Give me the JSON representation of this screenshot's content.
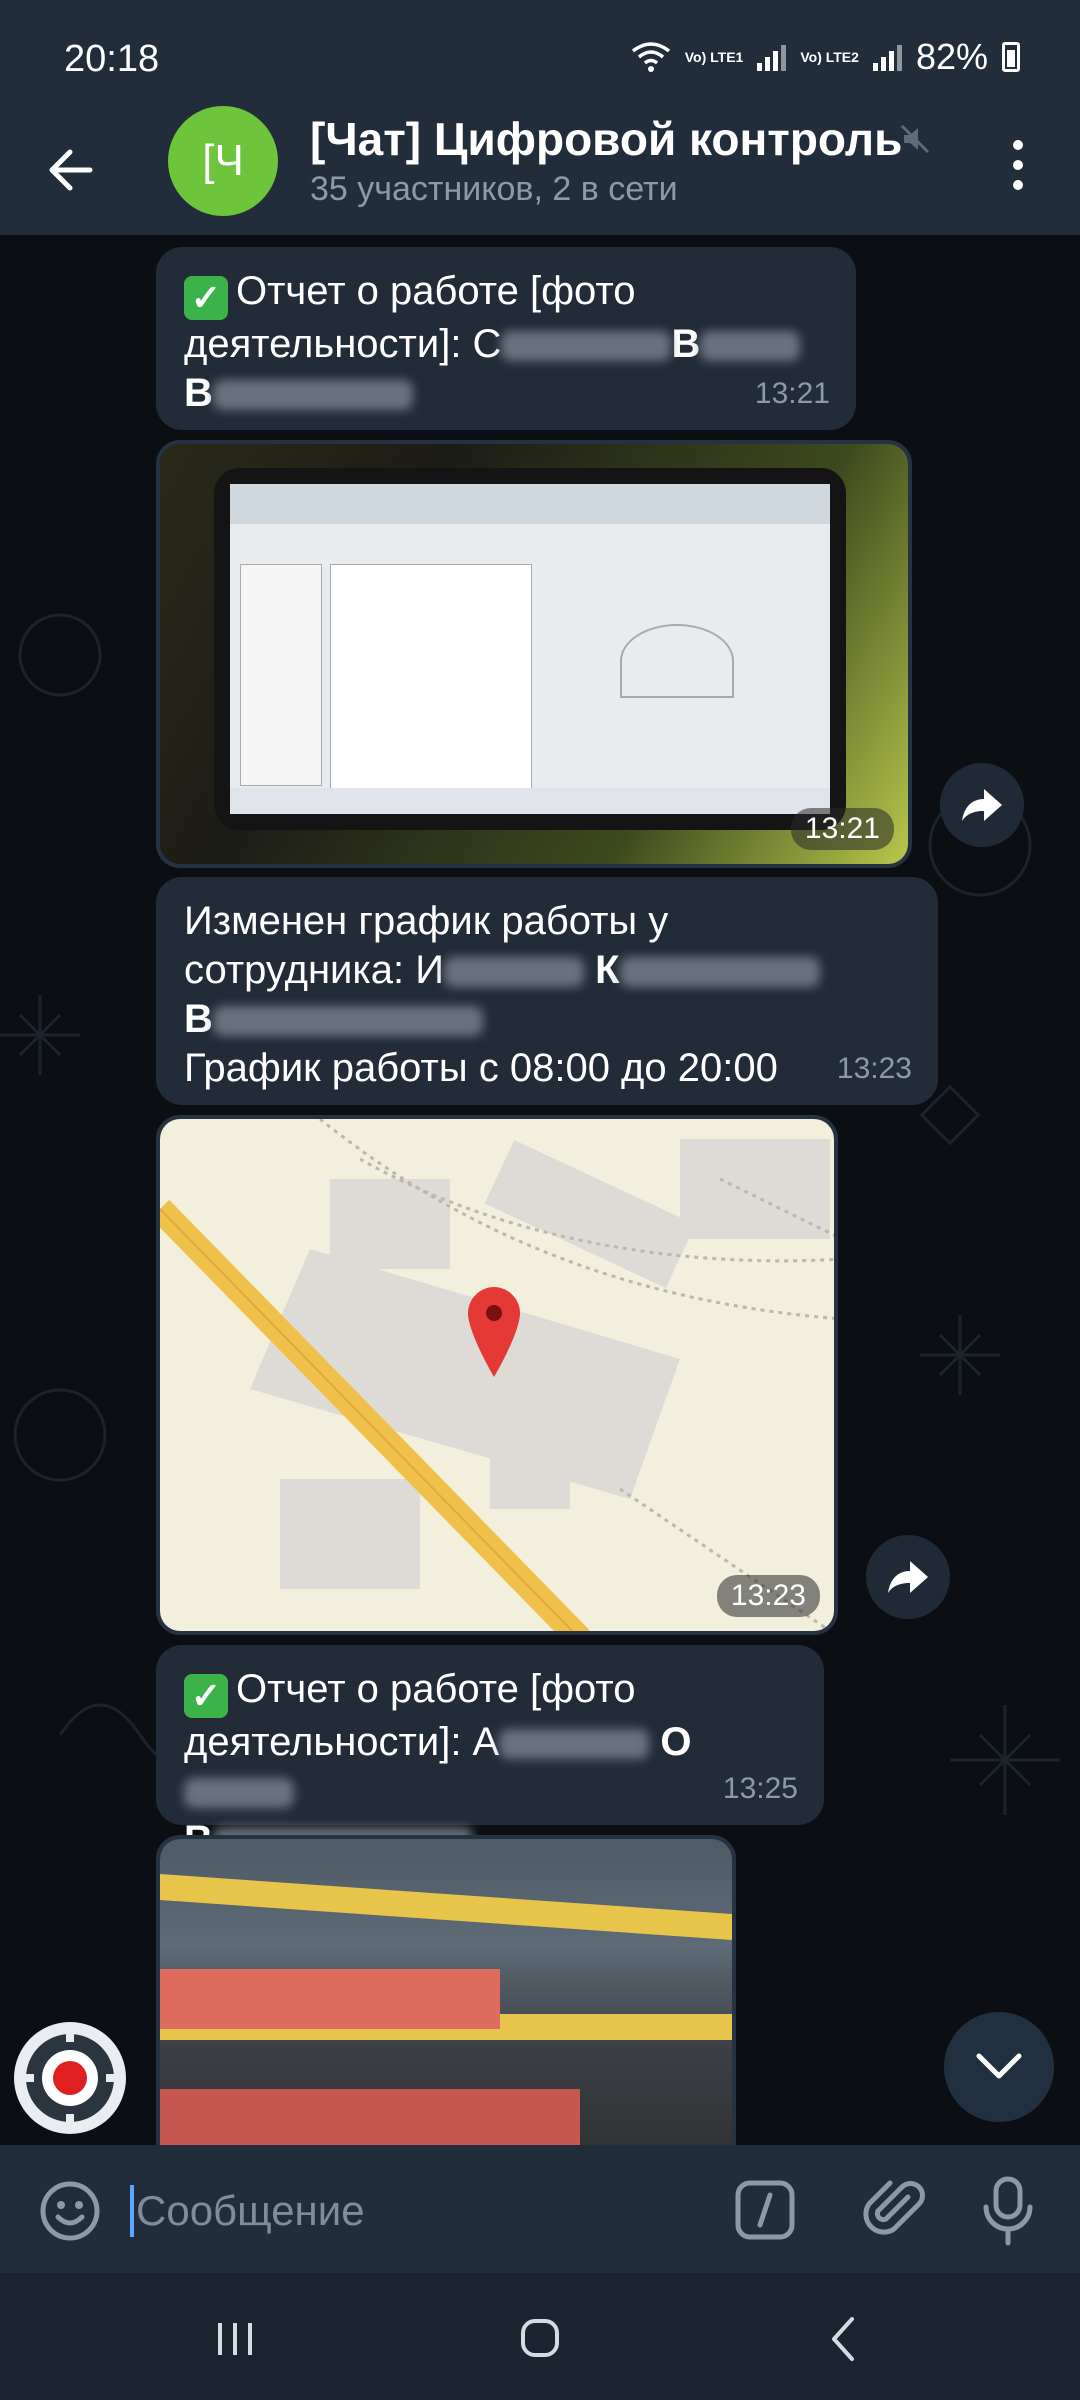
{
  "status_bar": {
    "time": "20:18",
    "sim1_label": "Vo) LTE1",
    "sim2_label": "Vo) LTE2",
    "battery": "82%"
  },
  "header": {
    "avatar_text": "[Ч",
    "avatar_color": "#6ec43a",
    "title": "[Чат] Цифровой контроль",
    "subtitle": "35 участников, 2 в сети"
  },
  "messages": {
    "msg1": {
      "line1": "Отчет о работе [фото",
      "line2_prefix": "деятельности]: С",
      "line2_initial2": "В",
      "line3_initial": "В",
      "time": "13:21"
    },
    "photo1": {
      "time": "13:21"
    },
    "msg2": {
      "line1": "Изменен график работы у",
      "line2_prefix": "сотрудника: И",
      "line2_initial2": "К",
      "line3_initial": "В",
      "line4": "График работы с 08:00 до 20:00",
      "time": "13:23"
    },
    "location": {
      "time": "13:23"
    },
    "msg3": {
      "line1": "Отчет о работе [фото",
      "line2_prefix": "деятельности]: А",
      "line2_initial2": "О",
      "line3_initial": "В",
      "time": "13:25"
    }
  },
  "input": {
    "placeholder": "Сообщение"
  },
  "colors": {
    "bubble": "#212c38",
    "header": "#212d3b",
    "accent": "#5aa9ff",
    "check": "#3bb34a"
  },
  "icons": {
    "back": "back-arrow-icon",
    "mute": "mute-icon",
    "menu": "kebab-menu-icon",
    "share": "forward-icon",
    "scroll": "chevron-down-icon",
    "emoji": "emoji-icon",
    "command": "slash-command-icon",
    "attach": "paperclip-icon",
    "mic": "microphone-icon"
  }
}
